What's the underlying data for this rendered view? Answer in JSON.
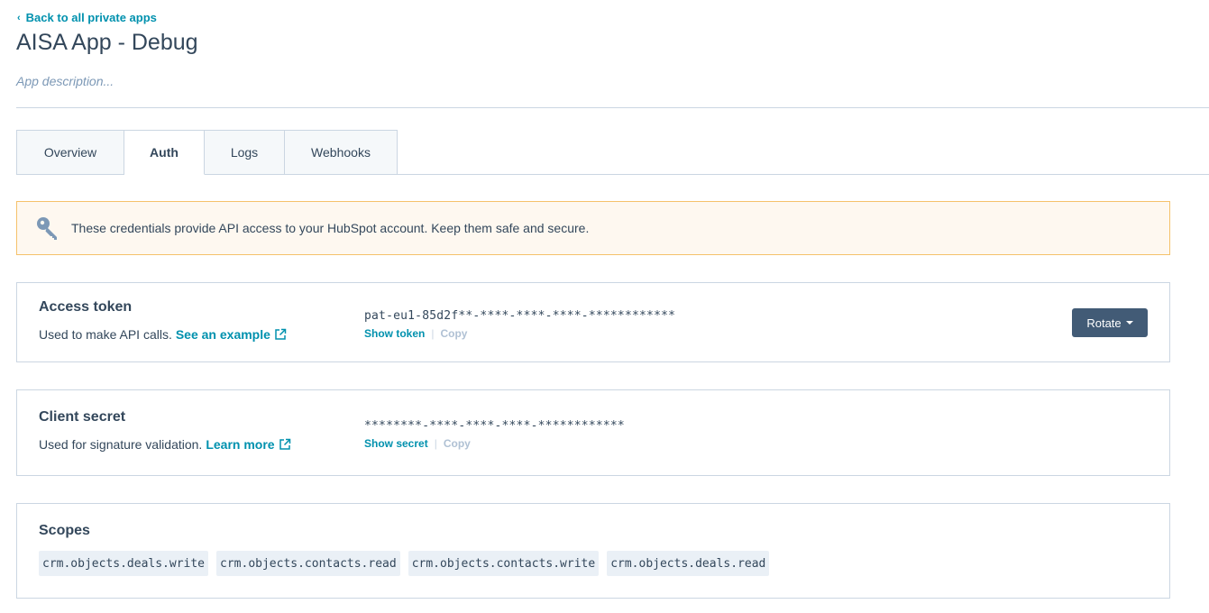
{
  "header": {
    "back_label": "Back to all private apps",
    "title": "AISA App - Debug",
    "description_placeholder": "App description..."
  },
  "tabs": [
    {
      "label": "Overview",
      "active": false
    },
    {
      "label": "Auth",
      "active": true
    },
    {
      "label": "Logs",
      "active": false
    },
    {
      "label": "Webhooks",
      "active": false
    }
  ],
  "alert": {
    "icon": "key-icon",
    "text": "These credentials provide API access to your HubSpot account. Keep them safe and secure."
  },
  "access_token": {
    "title": "Access token",
    "description": "Used to make API calls.",
    "link_label": "See an example",
    "value": "pat-eu1-85d2f**-****-****-****-************",
    "show_label": "Show token",
    "copy_label": "Copy",
    "rotate_label": "Rotate"
  },
  "client_secret": {
    "title": "Client secret",
    "description": "Used for signature validation.",
    "link_label": "Learn more",
    "value": "********-****-****-****-************",
    "show_label": "Show secret",
    "copy_label": "Copy"
  },
  "scopes": {
    "title": "Scopes",
    "items": [
      "crm.objects.deals.write",
      "crm.objects.contacts.read",
      "crm.objects.contacts.write",
      "crm.objects.deals.read"
    ]
  },
  "colors": {
    "link": "#0091ae",
    "text": "#33475b",
    "button": "#425b76",
    "alert_bg": "#fef8f0",
    "alert_border": "#f5c26b"
  }
}
